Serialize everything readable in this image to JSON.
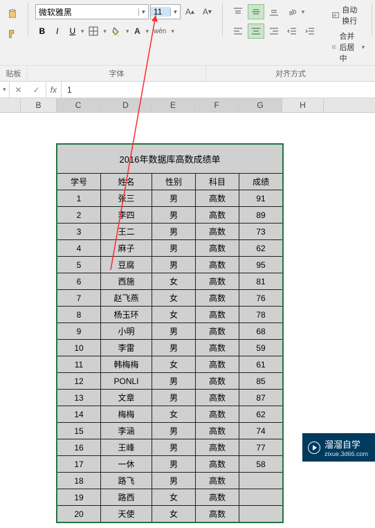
{
  "ribbon": {
    "font_name": "微软雅黑",
    "font_size": "11",
    "bold": "B",
    "italic": "I",
    "underline": "U",
    "wen": "wén",
    "wrap_text": "自动换行",
    "merge_center": "合并后居中",
    "group_clipboard": "贴板",
    "group_font": "字体",
    "group_align": "对齐方式"
  },
  "formula_bar": {
    "fx": "fx",
    "value": "1"
  },
  "columns": [
    "B",
    "C",
    "D",
    "E",
    "F",
    "G",
    "H"
  ],
  "table": {
    "title": "2016年数据库高数成绩单",
    "headers": [
      "学号",
      "姓名",
      "性别",
      "科目",
      "成绩"
    ],
    "rows": [
      [
        "1",
        "张三",
        "男",
        "高数",
        "91"
      ],
      [
        "2",
        "李四",
        "男",
        "高数",
        "89"
      ],
      [
        "3",
        "王二",
        "男",
        "高数",
        "73"
      ],
      [
        "4",
        "麻子",
        "男",
        "高数",
        "62"
      ],
      [
        "5",
        "豆腐",
        "男",
        "高数",
        "95"
      ],
      [
        "6",
        "西施",
        "女",
        "高数",
        "81"
      ],
      [
        "7",
        "赵飞燕",
        "女",
        "高数",
        "76"
      ],
      [
        "8",
        "杨玉环",
        "女",
        "高数",
        "78"
      ],
      [
        "9",
        "小明",
        "男",
        "高数",
        "68"
      ],
      [
        "10",
        "李雷",
        "男",
        "高数",
        "59"
      ],
      [
        "11",
        "韩梅梅",
        "女",
        "高数",
        "61"
      ],
      [
        "12",
        "PONLI",
        "男",
        "高数",
        "85"
      ],
      [
        "13",
        "文章",
        "男",
        "高数",
        "87"
      ],
      [
        "14",
        "梅梅",
        "女",
        "高数",
        "62"
      ],
      [
        "15",
        "李涵",
        "男",
        "高数",
        "74"
      ],
      [
        "16",
        "王峰",
        "男",
        "高数",
        "77"
      ],
      [
        "17",
        "一休",
        "男",
        "高数",
        "58"
      ],
      [
        "18",
        "路飞",
        "男",
        "高数",
        ""
      ],
      [
        "19",
        "路西",
        "女",
        "高数",
        ""
      ],
      [
        "20",
        "天使",
        "女",
        "高数",
        ""
      ]
    ]
  },
  "watermark": {
    "title": "溜溜自学",
    "sub": "zixue.3d66.com"
  }
}
